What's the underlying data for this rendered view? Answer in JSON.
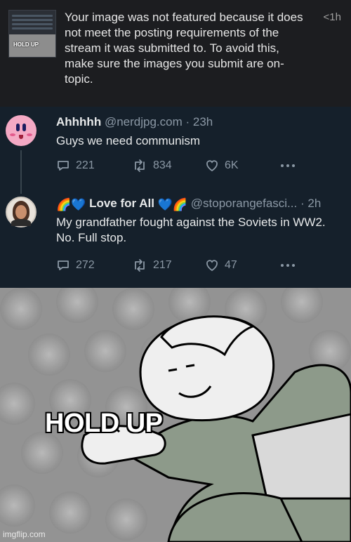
{
  "notification": {
    "message": "Your image was not featured because it does not meet the posting requirements of the stream it was submitted to. To avoid this, make sure the images you submit are on-topic.",
    "age": "<1h",
    "thumbnail_caption": "HOLD UP"
  },
  "tweets": [
    {
      "name": "Ahhhhh",
      "handle": "@nerdjpg.com",
      "time": "23h",
      "text": "Guys we need communism",
      "replies": "221",
      "retweets": "834",
      "likes": "6K",
      "avatar_icon": "kirby-avatar"
    },
    {
      "name_prefix_emoji": "🌈💙",
      "name": "Love for All",
      "name_suffix_emoji": "💙🌈",
      "handle": "@stoporangefasci...",
      "time": "2h",
      "text": "My grandfather fought against the Soviets in WW2. No. Full stop.",
      "replies": "272",
      "retweets": "217",
      "likes": "47",
      "avatar_icon": "woman-portrait-avatar"
    }
  ],
  "meme": {
    "caption": "HOLD UP",
    "watermark": "imgflip.com"
  },
  "colors": {
    "tweet_bg": "#15202b",
    "notif_bg": "#1c1d20",
    "meme_bg": "#9a9a9a",
    "text_primary": "#e7e9ea",
    "text_secondary": "#8b98a5"
  }
}
